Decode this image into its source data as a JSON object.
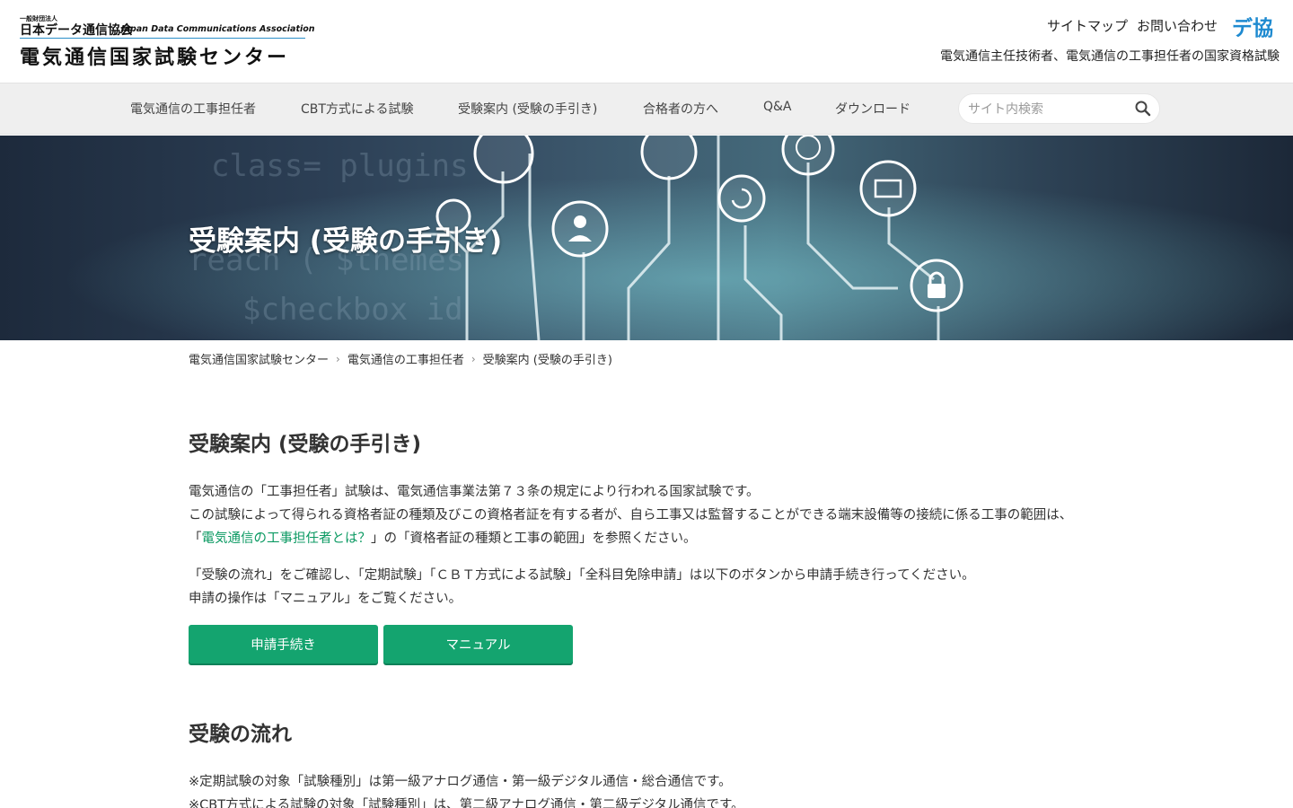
{
  "header": {
    "org_small": "一般財団法人",
    "org_name": "日本データ通信協会",
    "org_name_en": "Japan Data Communications Association",
    "center_name": "電気通信国家試験センター",
    "util_links": [
      "サイトマップ",
      "お問い合わせ"
    ],
    "brand_mark_text": "デ協",
    "tagline": "電気通信主任技術者、電気通信の工事担任者の国家資格試験"
  },
  "nav": {
    "items": [
      "電気通信の工事担任者",
      "CBT方式による試験",
      "受験案内 (受験の手引き)",
      "合格者の方へ",
      "Q&A",
      "ダウンロード"
    ],
    "search_placeholder": "サイト内検索"
  },
  "hero": {
    "title": "受験案内 (受験の手引き)"
  },
  "breadcrumb": [
    "電気通信国家試験センター",
    "電気通信の工事担任者",
    "受験案内 (受験の手引き)"
  ],
  "main": {
    "title": "受験案内 (受験の手引き)",
    "intro_line1": "電気通信の「工事担任者」試験は、電気通信事業法第７３条の規定により行われる国家試験です。",
    "intro_line2": "この試験によって得られる資格者証の種類及びこの資格者証を有する者が、自ら工事又は監督することができる端末設備等の接続に係る工事の範囲は、",
    "intro_line3_pre": "「",
    "intro_line3_link": "電気通信の工事担任者とは？",
    "intro_line3_post": "」の「資格者証の種類と工事の範囲」を参照ください。",
    "guide_line1": "「受験の流れ」をご確認し、「定期試験」「ＣＢＴ方式による試験」「全科目免除申請」は以下のボタンから申請手続き行ってください。",
    "guide_line2": "申請の操作は「マニュアル」をご覧ください。",
    "buttons": [
      "申請手続き",
      "マニュアル"
    ],
    "flow_title": "受験の流れ",
    "flow_note1": "※定期試験の対象「試験種別」は第一級アナログ通信・第一級デジタル通信・総合通信です。",
    "flow_note2": "※CBT方式による試験の対象「試験種別」は、第二級アナログ通信・第二級デジタル通信です。"
  },
  "colors": {
    "accent": "#14a46f",
    "link": "#0c9a63",
    "nav_bg": "#efefef",
    "brand_blue": "#1e8ad0"
  }
}
